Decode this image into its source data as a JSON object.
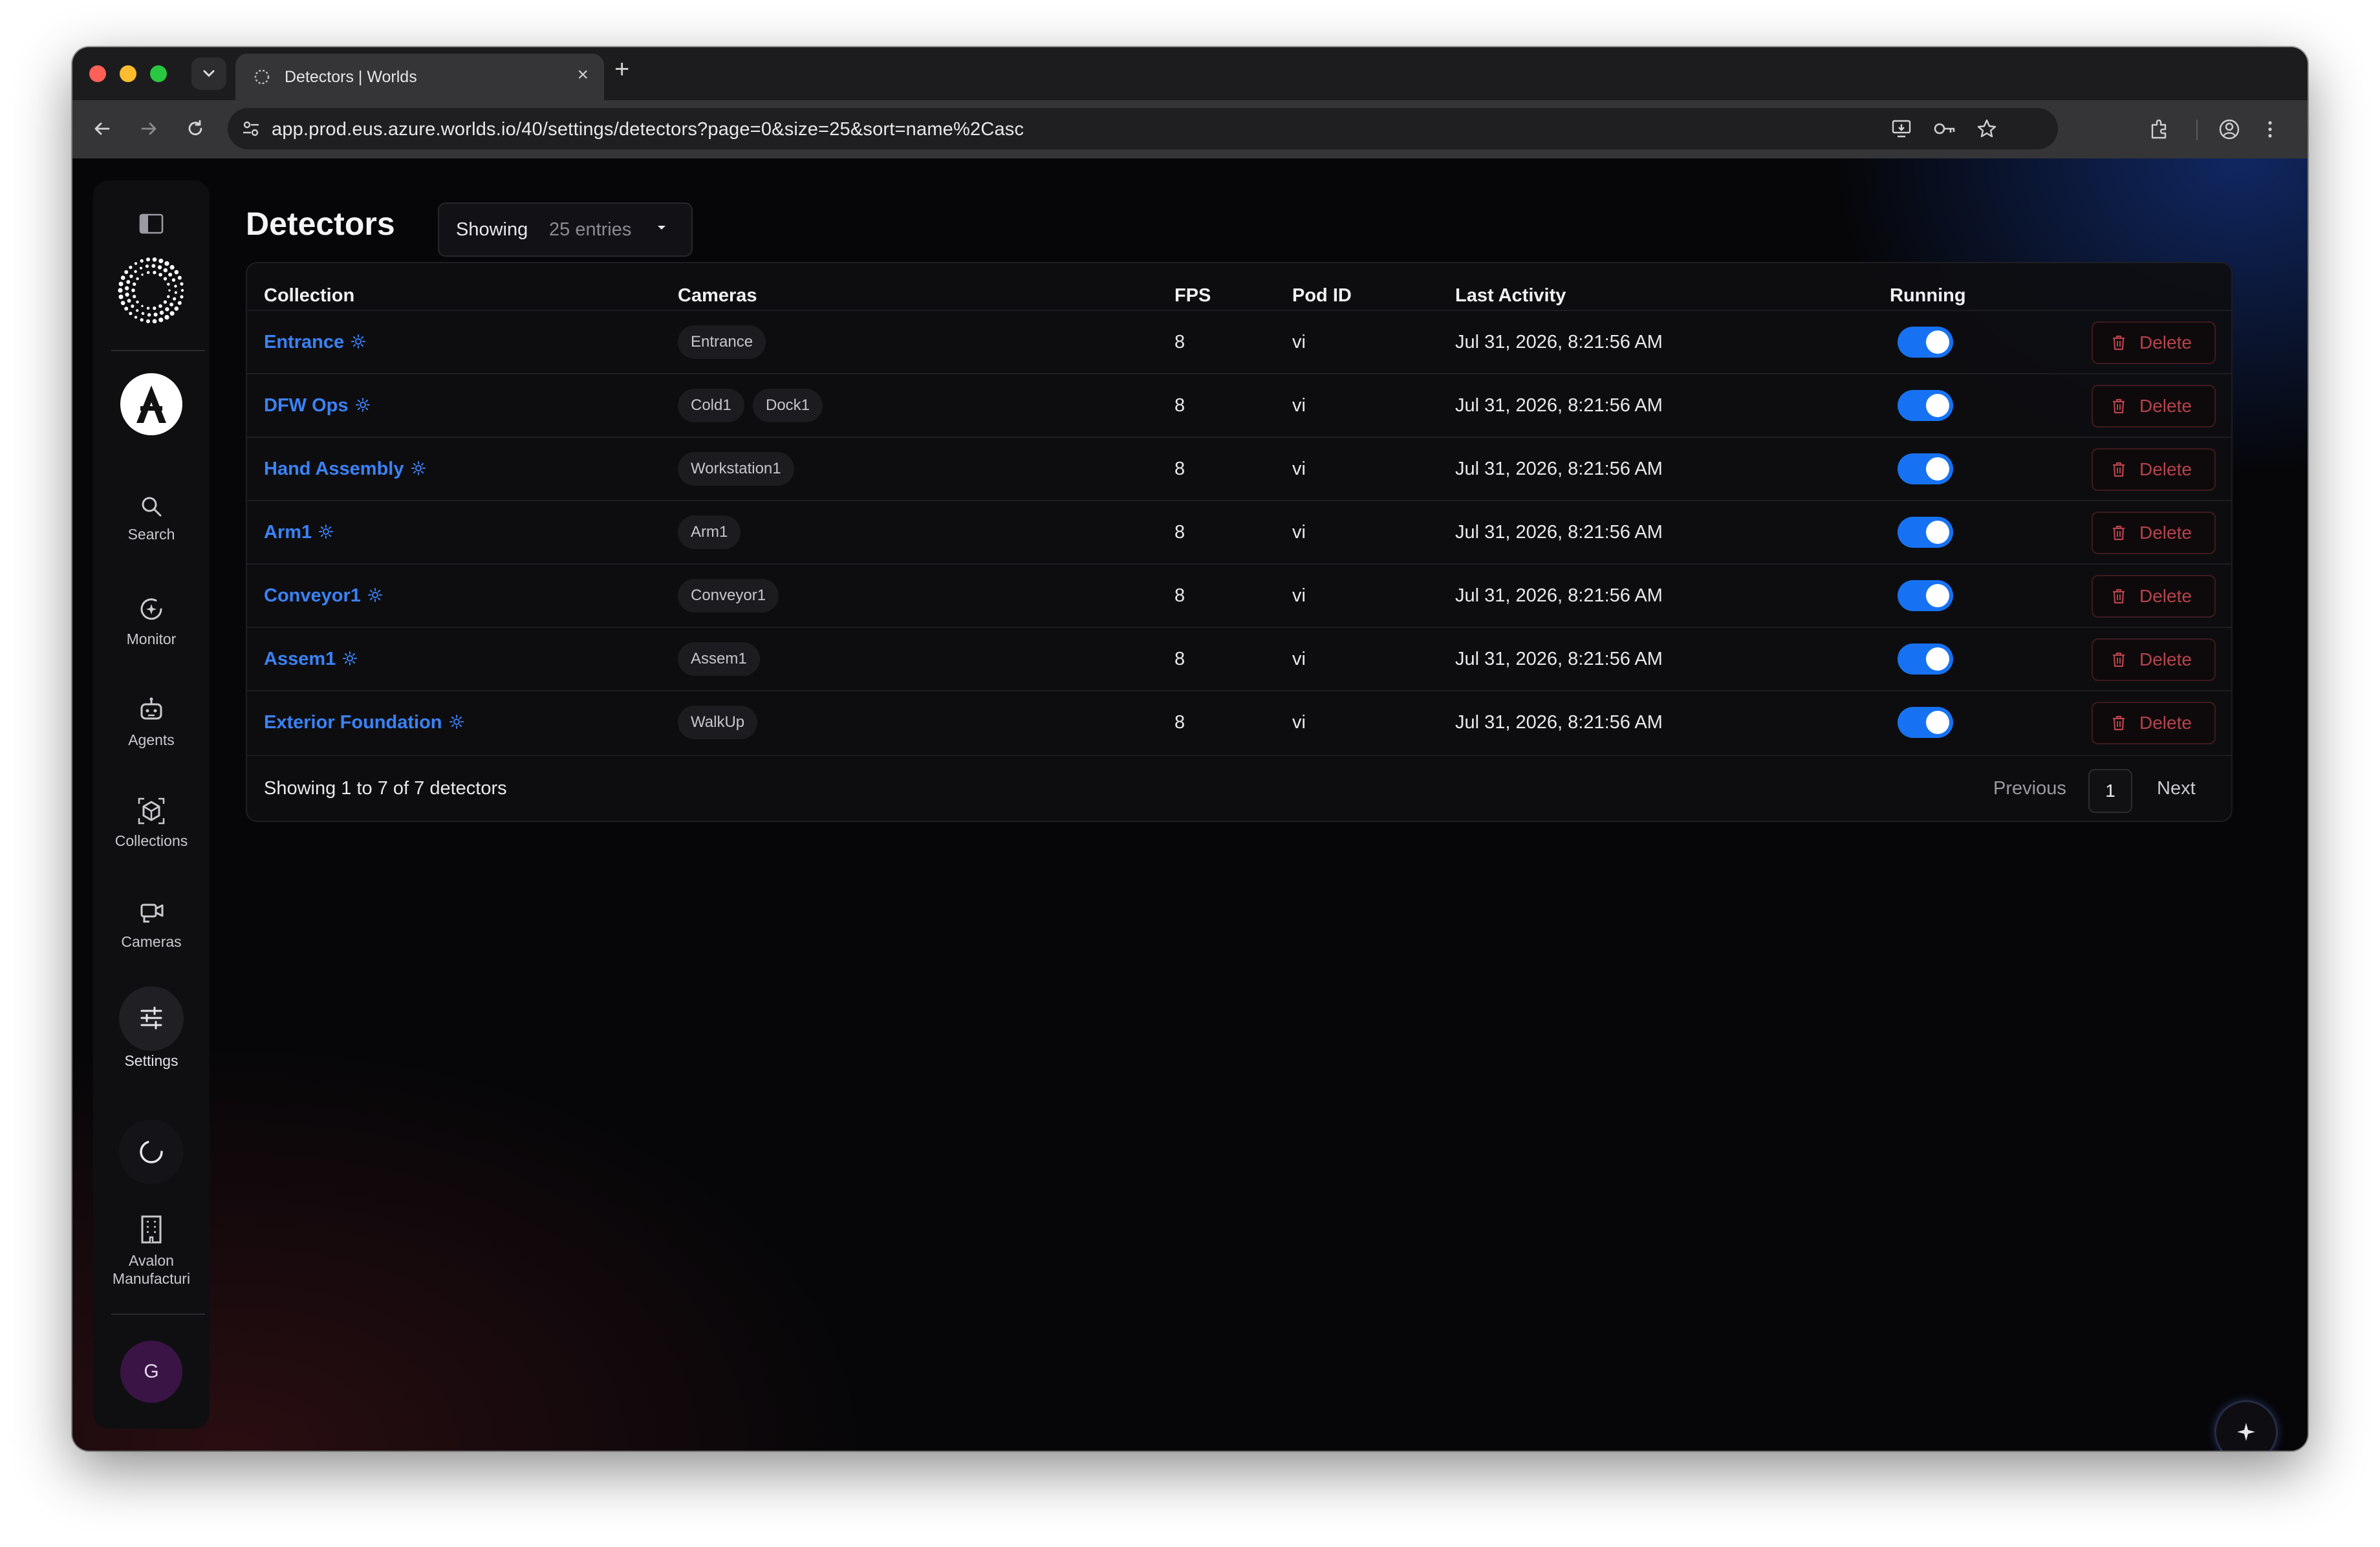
{
  "browser": {
    "tab_title": "Detectors | Worlds",
    "url": "app.prod.eus.azure.worlds.io/40/settings/detectors?page=0&size=25&sort=name%2Casc"
  },
  "sidebar": {
    "items": [
      {
        "label": "Search",
        "icon": "search-icon"
      },
      {
        "label": "Monitor",
        "icon": "monitor-icon"
      },
      {
        "label": "Agents",
        "icon": "robot-icon"
      },
      {
        "label": "Collections",
        "icon": "cube-icon"
      },
      {
        "label": "Cameras",
        "icon": "camera-icon"
      },
      {
        "label": "Settings",
        "icon": "sliders-icon"
      }
    ],
    "org": {
      "label_line1": "Avalon",
      "label_line2": "Manufacturi"
    },
    "user_initial": "G"
  },
  "page": {
    "title": "Detectors",
    "entries_label": "Showing",
    "entries_value": "25 entries"
  },
  "table": {
    "headers": {
      "collection": "Collection",
      "cameras": "Cameras",
      "fps": "FPS",
      "pod_id": "Pod ID",
      "last_activity": "Last Activity",
      "running": "Running"
    },
    "rows": [
      {
        "collection": "Entrance",
        "cameras": [
          "Entrance"
        ],
        "fps": "8",
        "pod_id": "vi",
        "last_activity": "Jul 31, 2026, 8:21:56 AM",
        "running": true,
        "action": "Delete"
      },
      {
        "collection": "DFW Ops",
        "cameras": [
          "Cold1",
          "Dock1"
        ],
        "fps": "8",
        "pod_id": "vi",
        "last_activity": "Jul 31, 2026, 8:21:56 AM",
        "running": true,
        "action": "Delete"
      },
      {
        "collection": "Hand Assembly",
        "cameras": [
          "Workstation1"
        ],
        "fps": "8",
        "pod_id": "vi",
        "last_activity": "Jul 31, 2026, 8:21:56 AM",
        "running": true,
        "action": "Delete"
      },
      {
        "collection": "Arm1",
        "cameras": [
          "Arm1"
        ],
        "fps": "8",
        "pod_id": "vi",
        "last_activity": "Jul 31, 2026, 8:21:56 AM",
        "running": true,
        "action": "Delete"
      },
      {
        "collection": "Conveyor1",
        "cameras": [
          "Conveyor1"
        ],
        "fps": "8",
        "pod_id": "vi",
        "last_activity": "Jul 31, 2026, 8:21:56 AM",
        "running": true,
        "action": "Delete"
      },
      {
        "collection": "Assem1",
        "cameras": [
          "Assem1"
        ],
        "fps": "8",
        "pod_id": "vi",
        "last_activity": "Jul 31, 2026, 8:21:56 AM",
        "running": true,
        "action": "Delete"
      },
      {
        "collection": "Exterior Foundation",
        "cameras": [
          "WalkUp"
        ],
        "fps": "8",
        "pod_id": "vi",
        "last_activity": "Jul 31, 2026, 8:21:56 AM",
        "running": true,
        "action": "Delete"
      }
    ],
    "footer": {
      "summary": "Showing 1 to 7 of 7 detectors",
      "previous": "Previous",
      "current_page": "1",
      "next": "Next"
    }
  },
  "colors": {
    "accent": "#3b82f6",
    "toggle_on": "#1672f3",
    "danger": "#b7424c"
  }
}
